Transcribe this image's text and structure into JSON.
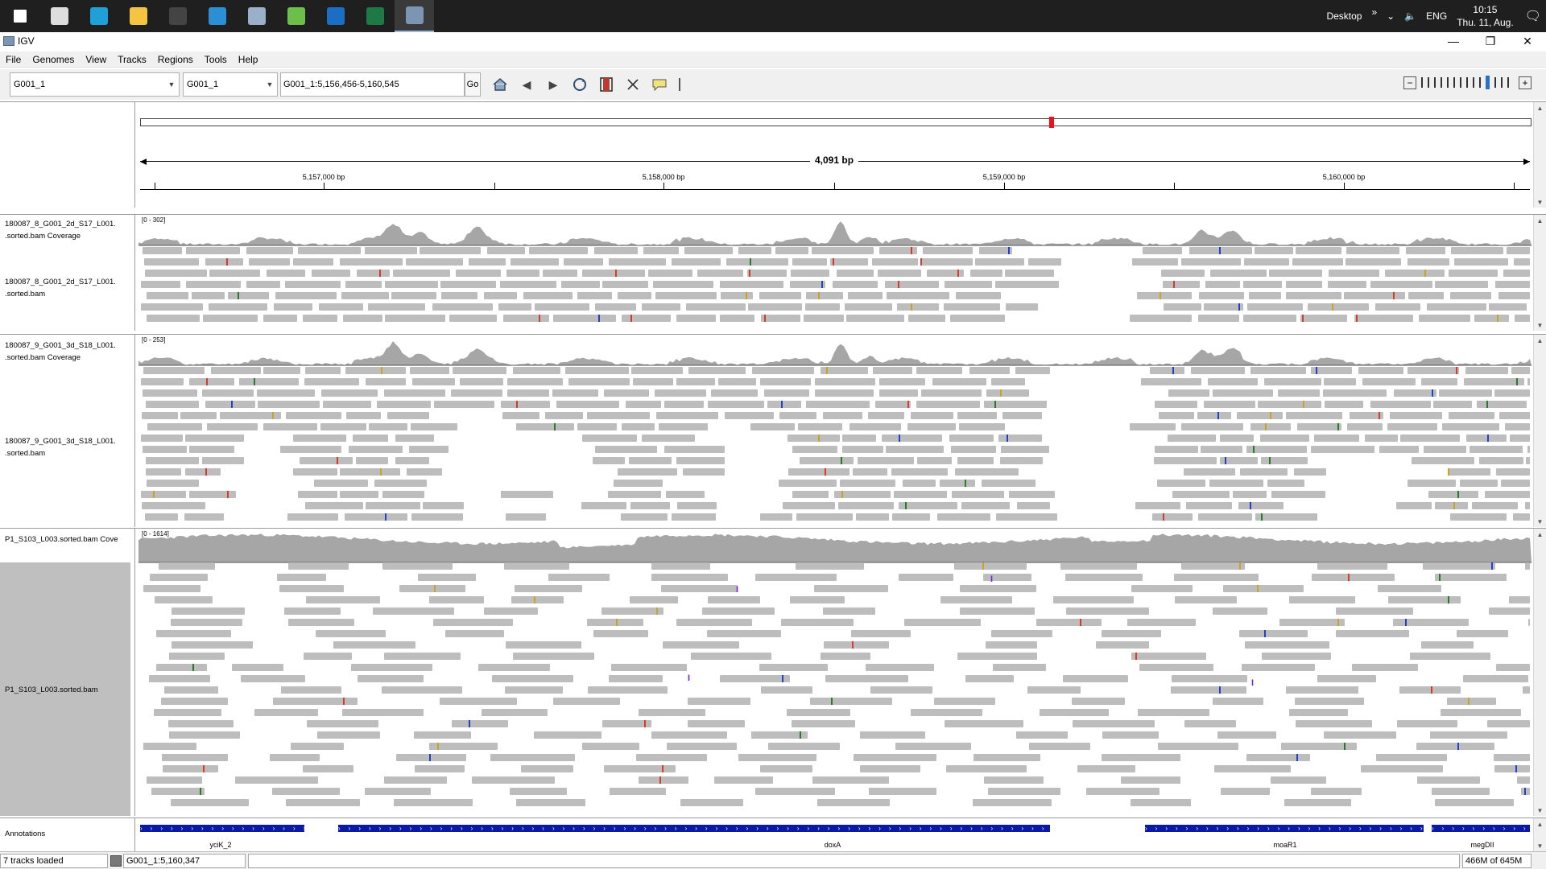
{
  "taskbar": {
    "apps": [
      {
        "icon": "windows-start-icon",
        "color": "#ffffff"
      },
      {
        "icon": "task-view-icon",
        "color": "#dddddd"
      },
      {
        "icon": "edge-browser-icon",
        "color": "#1fa0d8"
      },
      {
        "icon": "file-explorer-icon",
        "color": "#f5c542"
      },
      {
        "icon": "terminal-icon",
        "color": "#444444"
      },
      {
        "icon": "vscode-icon",
        "color": "#2b8fd6"
      },
      {
        "icon": "network-drive-icon",
        "color": "#9ab0c8"
      },
      {
        "icon": "notepad-icon",
        "color": "#6cbf4a"
      },
      {
        "icon": "outlook-icon",
        "color": "#1b6ec2"
      },
      {
        "icon": "excel-icon",
        "color": "#1e7a44"
      },
      {
        "icon": "igv-app-icon",
        "color": "#7c95b3"
      }
    ],
    "desktop_label": "Desktop",
    "overflow": "»",
    "lang": "ENG",
    "time": "10:15",
    "date": "Thu. 11, Aug."
  },
  "window": {
    "title": "IGV",
    "minimize": "—",
    "restore": "❐",
    "close": "✕"
  },
  "menu": [
    "File",
    "Genomes",
    "View",
    "Tracks",
    "Regions",
    "Tools",
    "Help"
  ],
  "toolbar": {
    "genome": "G001_1",
    "chromosome": "G001_1",
    "locus": "G001_1:5,156,456-5,160,545",
    "go_label": "Go",
    "zoom_out": "−",
    "zoom_in": "+",
    "zoom_level": 10,
    "zoom_steps": 14
  },
  "ruler": {
    "span_label": "4,091 bp",
    "ticks": [
      "5,157,000 bp",
      "5,158,000 bp",
      "5,159,000 bp",
      "5,160,000 bp"
    ]
  },
  "tracks": {
    "t1_cov": "180087_8_G001_2d_S17_L001.\n.sorted.bam Coverage",
    "t1_bam": "180087_8_G001_2d_S17_L001.\n.sorted.bam",
    "t1_range": "[0 - 302]",
    "t2_cov": "180087_9_G001_3d_S18_L001.\n.sorted.bam Coverage",
    "t2_bam": "180087_9_G001_3d_S18_L001.\n.sorted.bam",
    "t2_range": "[0 - 253]",
    "t3_cov": "P1_S103_L003.sorted.bam Cove",
    "t3_bam": "P1_S103_L003.sorted.bam",
    "t3_range": "[0 - 1614]",
    "annotations": "Annotations"
  },
  "genes": [
    "yciK_2",
    "doxA",
    "moaR1",
    "megDII"
  ],
  "status": {
    "tracks_loaded": "7 tracks loaded",
    "position": "G001_1:5,160,347",
    "memory": "466M of 645M"
  },
  "colors": {
    "read_gray": "#bdbdbd",
    "coverage_gray": "#a6a6a6",
    "annotation_blue": "#0a1aa5",
    "insertion_purple": "#7a1fd6"
  }
}
